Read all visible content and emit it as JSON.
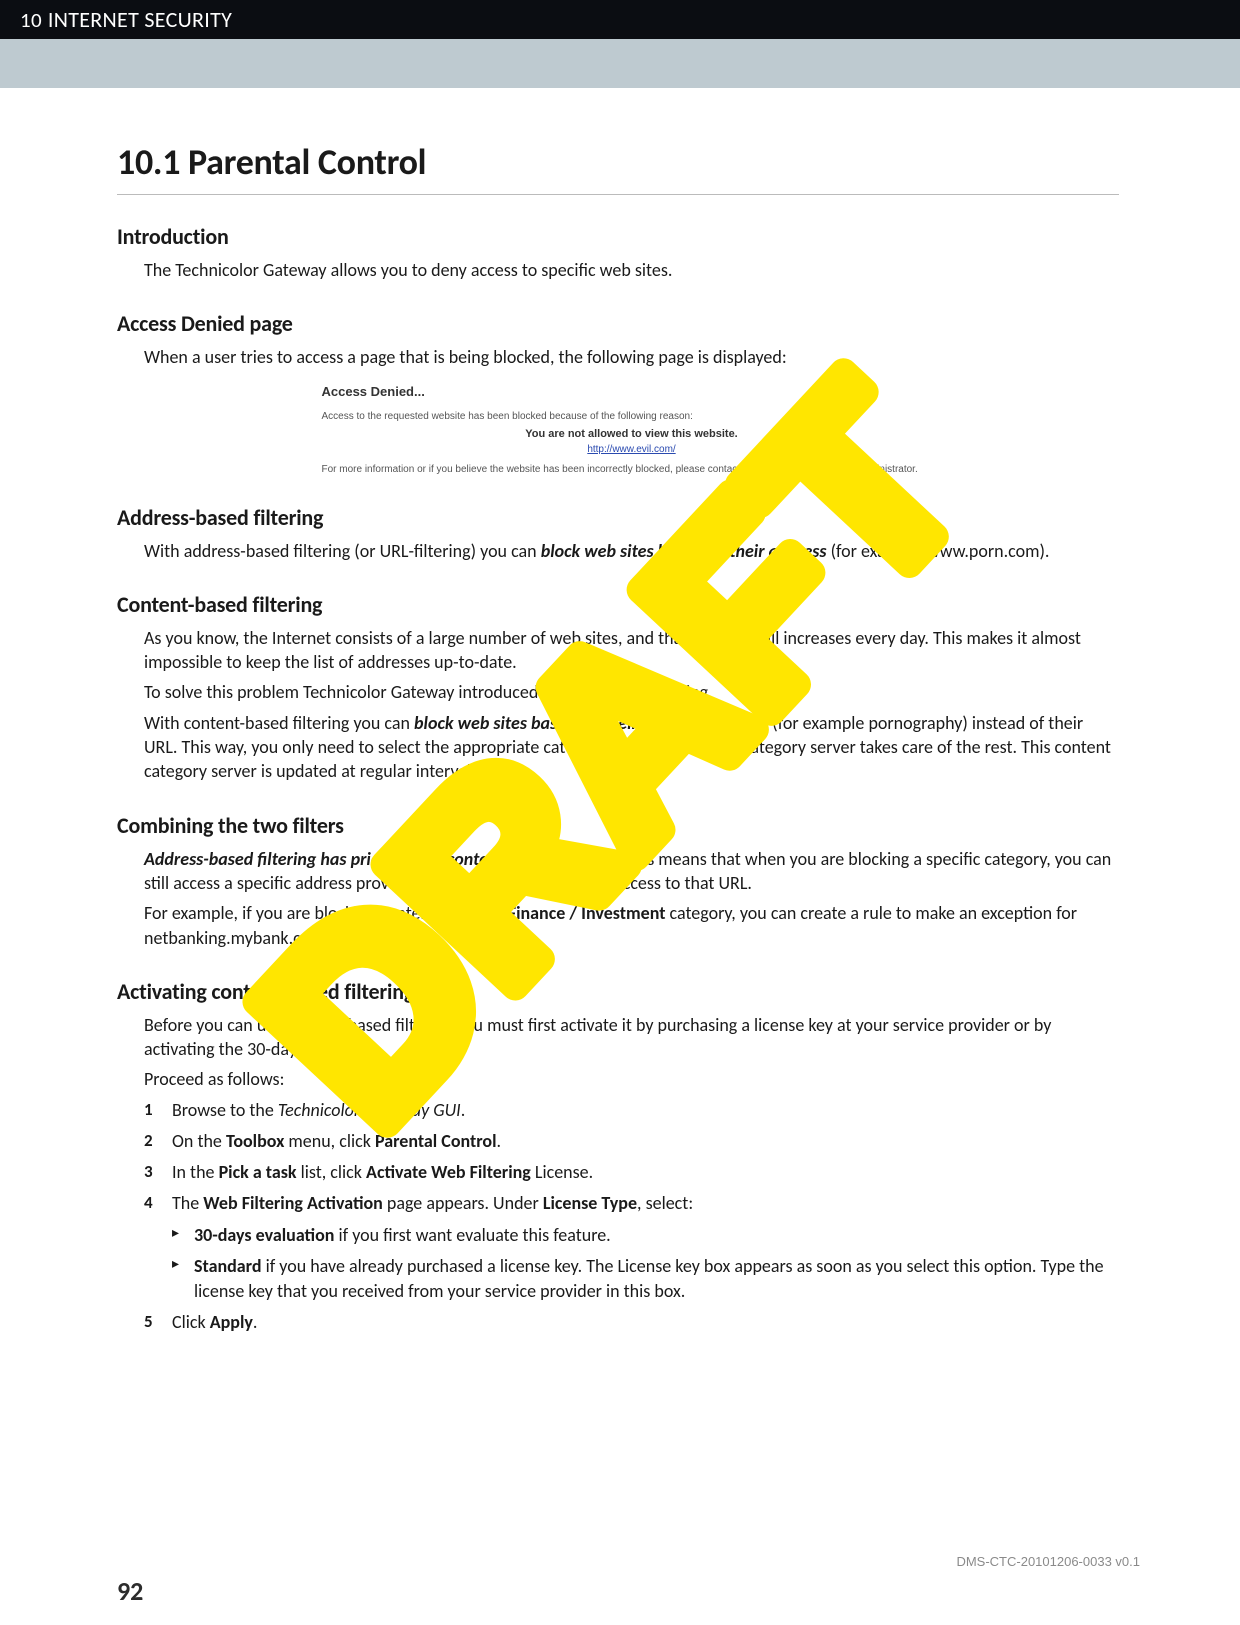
{
  "header": {
    "chapter_number": "10",
    "chapter_title": "INTERNET SECURITY"
  },
  "section": {
    "number_title": "10.1 Parental Control"
  },
  "intro": {
    "heading": "Introduction",
    "p1": "The Technicolor Gateway allows you to deny access to specific web sites."
  },
  "denied": {
    "heading": "Access Denied page",
    "p1": "When a user tries to access a page that is being blocked, the following page is displayed:",
    "box": {
      "title": "Access Denied...",
      "reason": "Access to the requested website has been blocked because of the following reason:",
      "not_allowed": "You are not allowed to view this website.",
      "url": "http://www.evil.com/",
      "more": "For more information or if you believe the website has been incorrectly blocked, please contact your Technicolor Gatewayadministrator."
    }
  },
  "address": {
    "heading": "Address-based filtering",
    "p1a": "With address-based filtering (or URL-filtering) you can ",
    "p1b": "block web sites based on their address",
    "p1c": " (for example www.porn.com)."
  },
  "content_sec": {
    "heading": "Content-based filtering",
    "p1": "As you know, the Internet consists of a large number of web sites, and that number still increases every day. This makes it almost impossible to keep the list of addresses up-to-date.",
    "p2": "To solve this problem Technicolor Gateway introduced content-based filtering.",
    "p3a": "With content-based filtering you can ",
    "p3b": "block web sites based on their content category",
    "p3c": " (for example pornography) instead of their URL. This way, you only need to select the appropriate categories and the content category server takes care of the rest. This content category server is updated at regular intervals."
  },
  "combine": {
    "heading": "Combining the two filters",
    "p1a": "Address-based filtering has priority over content-based filtering",
    "p1b": ". This means that when you are blocking a specific category, you can still access a specific address provided you create a rule to allow access to that URL.",
    "p2a": "For example, if you are blocking content from the ",
    "p2b": "Finance / Investment",
    "p2c": " category, you can create a rule to make an exception for netbanking.mybank.com."
  },
  "activate": {
    "heading": "Activating content-based filtering",
    "p1": "Before you can use content-based filtering you must first activate it by purchasing a license key at your service provider or by activating the 30-day trial.",
    "p2": "Proceed as follows:",
    "steps": {
      "s1a": "Browse to the ",
      "s1b": "Technicolor Gateway GUI",
      "s1c": ".",
      "s2a": "On the ",
      "s2b": "Toolbox",
      "s2c": " menu, click ",
      "s2d": "Parental Control",
      "s2e": ".",
      "s3a": "In the ",
      "s3b": "Pick a task",
      "s3c": " list, click ",
      "s3d": "Activate Web Filtering",
      "s3e": " License.",
      "s4a": "The ",
      "s4b": "Web Filtering Activation",
      "s4c": " page appears. Under ",
      "s4d": "License Type",
      "s4e": ", select:",
      "s4_sub1a": "30-days evaluation",
      "s4_sub1b": " if you first want evaluate this feature.",
      "s4_sub2a": "Standard",
      "s4_sub2b": " if you have already purchased a license key. The License key box appears as soon as you select this option. Type the license key that you received from your service provider in this box.",
      "s5a": "Click ",
      "s5b": "Apply",
      "s5c": "."
    }
  },
  "footer": {
    "code": "DMS-CTC-20101206-0033 v0.1",
    "page": "92"
  },
  "watermark": {
    "text": "DRAFT"
  }
}
